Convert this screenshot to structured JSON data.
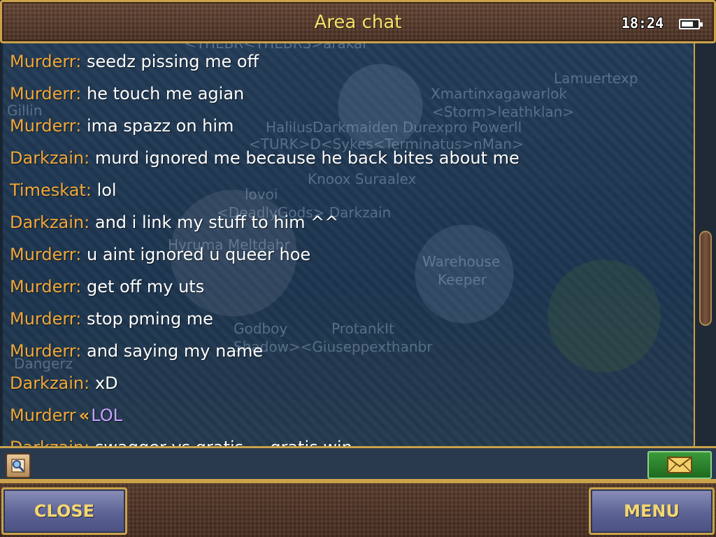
{
  "header": {
    "title": "Area chat",
    "clock": "18:24"
  },
  "scene_labels": [
    "<THEBR<THEBRS>arakar",
    "Lamuertexp",
    "Xmartinxagawarlok",
    "<Storm>leathklan>",
    "HalilusDarkmaiden Durexpro Powerll",
    "<TURK>D<Sykes<Terminatus>nMan>",
    "Knoox Suraalex",
    "lovoi",
    "<DeadlyGods> Darkzain",
    "Hyruma Meltdahr",
    "Warehouse",
    "Keeper",
    "Godboy",
    "ProtankIt",
    "Shadow><Giuseppexthanbr",
    "Dangerz",
    "Gillin"
  ],
  "chat": {
    "messages": [
      {
        "name": "Murderr:",
        "text": "seedz pissing me off"
      },
      {
        "name": "Murderr:",
        "text": "he touch me agian"
      },
      {
        "name": "Murderr:",
        "text": "ima spazz on him"
      },
      {
        "name": "Darkzain:",
        "text": "murd ignored me because he back bites about me"
      },
      {
        "name": "Timeskat:",
        "text": "lol"
      },
      {
        "name": "Darkzain:",
        "text": "and i link my stuff to him ^^"
      },
      {
        "name": "Murderr:",
        "text": "u aint ignored u queer hoe"
      },
      {
        "name": "Murderr:",
        "text": "get off my uts"
      },
      {
        "name": "Murderr:",
        "text": "stop pming me"
      },
      {
        "name": "Murderr:",
        "text": "and saying my name"
      },
      {
        "name": "Darkzain:",
        "text": "xD"
      }
    ],
    "whisper": {
      "name": "Murderr",
      "mark": "«",
      "text": "LOL"
    },
    "partial": {
      "name": "Darkzain:",
      "text": "swagger vs gratis ... gratis win"
    }
  },
  "input": {
    "placeholder": ""
  },
  "buttons": {
    "close": "CLOSE",
    "menu": "MENU"
  },
  "colors": {
    "name": "#f0a83a",
    "whisper": "#c8a2ff",
    "title": "#f4e36a",
    "button_text": "#f4d870",
    "frame": "#c9a24a"
  }
}
